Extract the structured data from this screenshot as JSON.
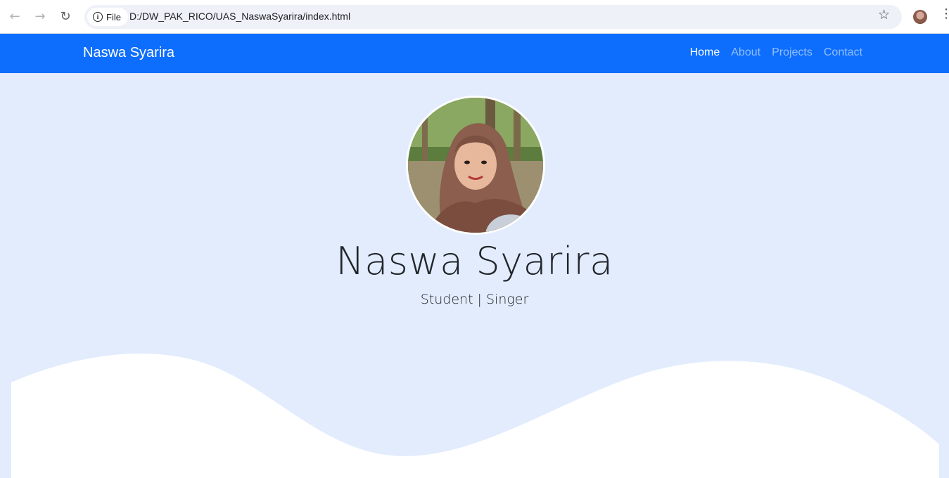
{
  "browser": {
    "file_label": "File",
    "url": "D:/DW_PAK_RICO/UAS_NaswaSyarira/index.html",
    "icons": {
      "back": "arrow-left",
      "forward": "arrow-right",
      "reload": "reload",
      "info": "info",
      "bookmark": "star",
      "menu": "vertical-dots"
    }
  },
  "navbar": {
    "brand": "Naswa Syarira",
    "links": [
      {
        "label": "Home",
        "active": true
      },
      {
        "label": "About",
        "active": false
      },
      {
        "label": "Projects",
        "active": false
      },
      {
        "label": "Contact",
        "active": false
      }
    ],
    "color": "#0d6efd"
  },
  "hero": {
    "name": "Naswa Syarira",
    "tagline": "Student | Singer",
    "background": "#e2ecfd"
  }
}
